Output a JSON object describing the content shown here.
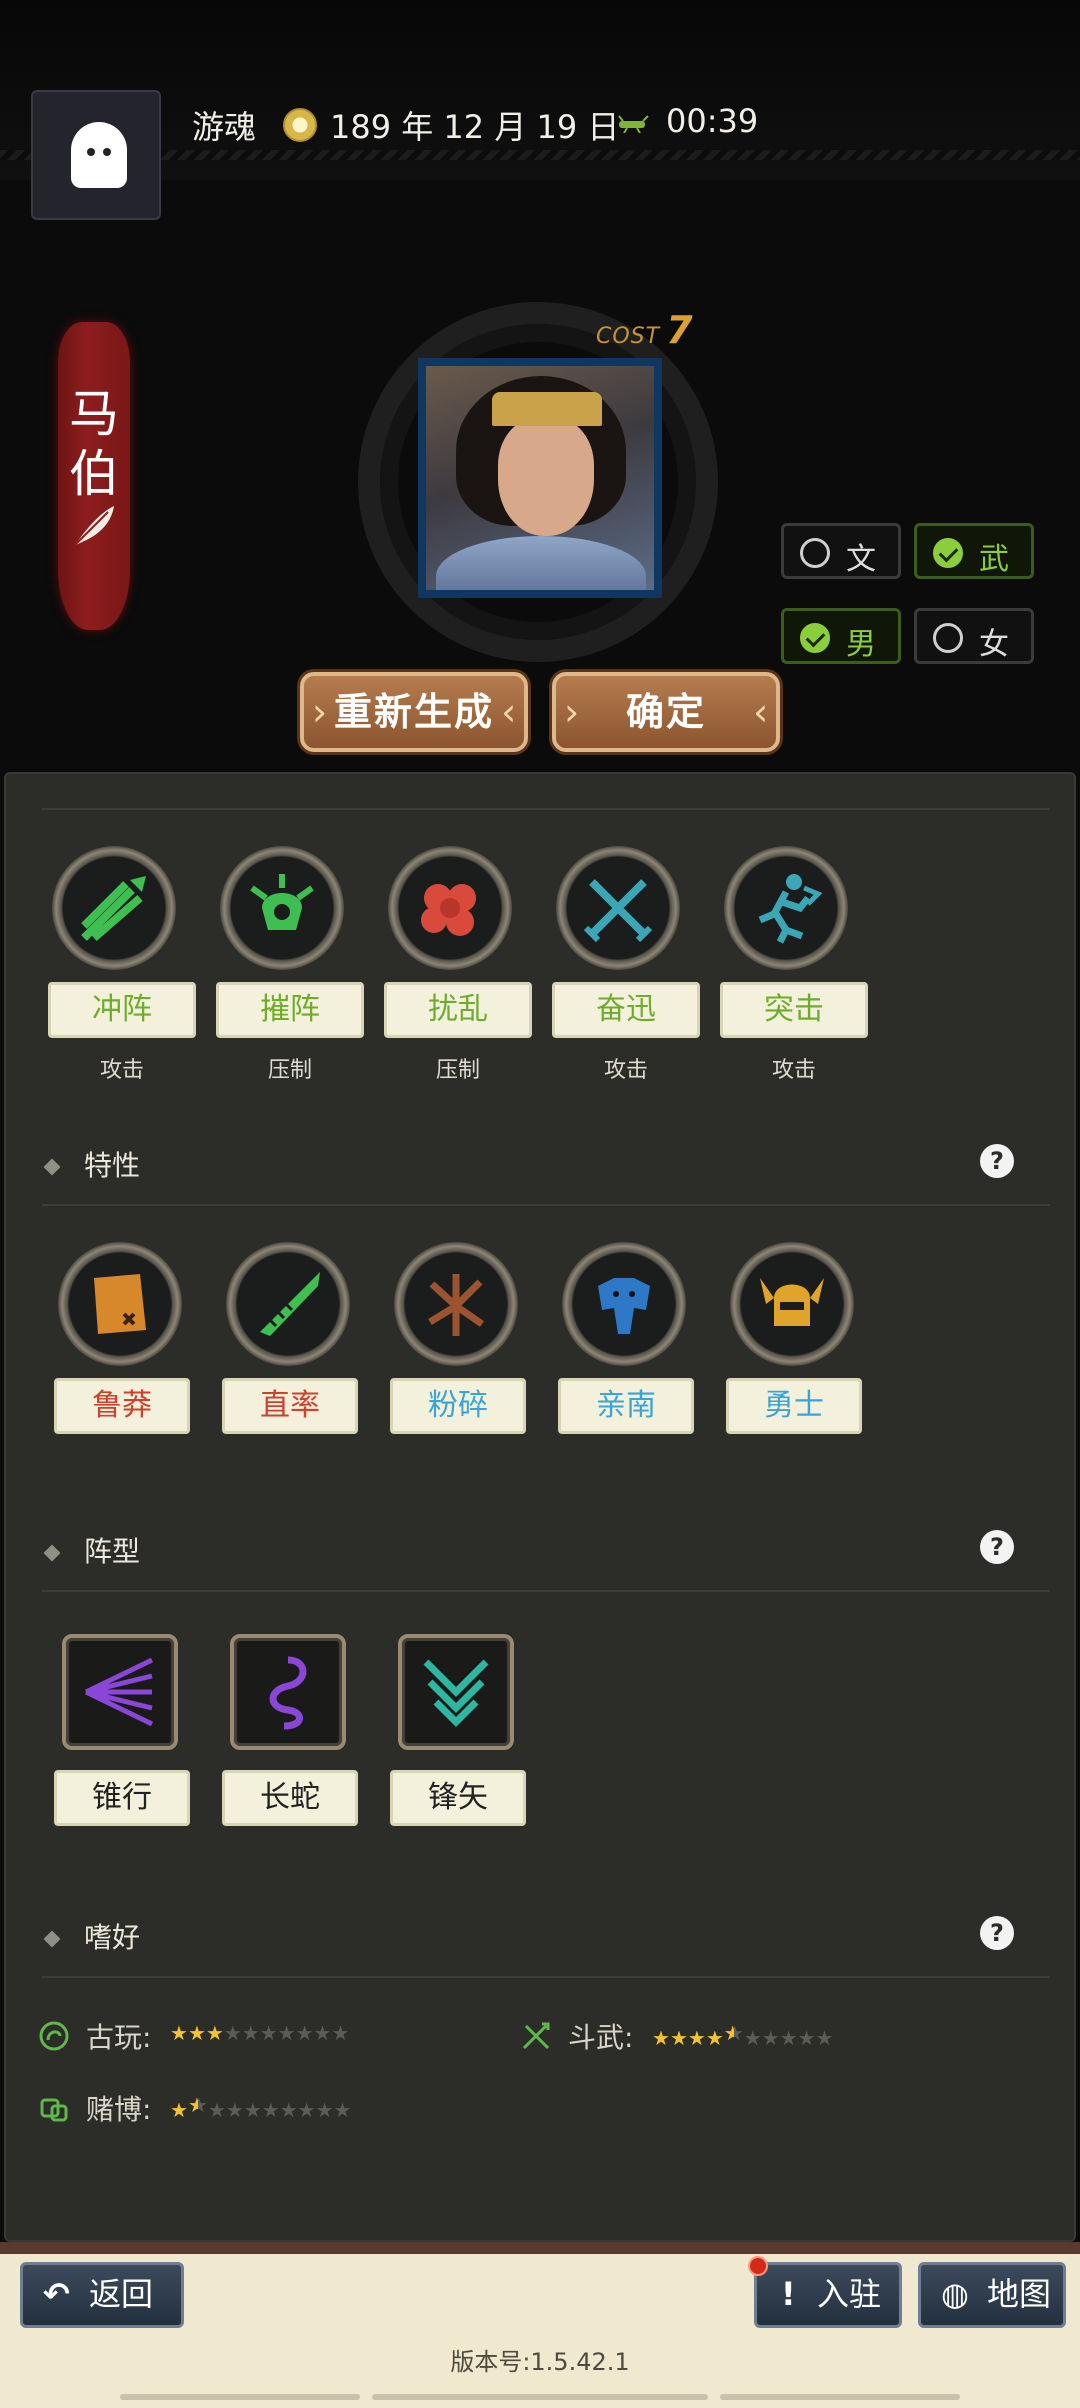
{
  "header": {
    "player_name": "游魂",
    "date": "189 年 12 月 19 日",
    "time": "00:39",
    "coin_icon": "era-coin-icon",
    "clock_icon": "bug-icon"
  },
  "character": {
    "name_chars": [
      "马",
      "伯"
    ],
    "cost_label": "COST",
    "cost_value": "7",
    "toggles": [
      {
        "label": "文",
        "checked": false
      },
      {
        "label": "武",
        "checked": true
      },
      {
        "label": "男",
        "checked": true
      },
      {
        "label": "女",
        "checked": false
      }
    ],
    "regenerate_label": "重新生成",
    "confirm_label": "确定"
  },
  "skills": [
    {
      "label": "冲阵",
      "type": "攻击",
      "icon": "charge-arrows-icon"
    },
    {
      "label": "摧阵",
      "type": "压制",
      "icon": "crush-icon"
    },
    {
      "label": "扰乱",
      "type": "压制",
      "icon": "chaos-cloud-icon"
    },
    {
      "label": "奋迅",
      "type": "攻击",
      "icon": "crossed-swords-icon"
    },
    {
      "label": "突击",
      "type": "攻击",
      "icon": "assault-runner-icon"
    }
  ],
  "traits": {
    "title": "特性",
    "items": [
      {
        "label": "鲁莽",
        "color": "#d0402f",
        "icon": "map-scroll-icon"
      },
      {
        "label": "直率",
        "color": "#d0402f",
        "icon": "arrow-blade-icon"
      },
      {
        "label": "粉碎",
        "color": "#3aa4d6",
        "icon": "shatter-icon"
      },
      {
        "label": "亲南",
        "color": "#3aa4d6",
        "icon": "elephant-icon"
      },
      {
        "label": "勇士",
        "color": "#3aa4d6",
        "icon": "horned-helmet-icon"
      }
    ]
  },
  "formations": {
    "title": "阵型",
    "items": [
      {
        "label": "锥行",
        "icon": "cone-formation-icon"
      },
      {
        "label": "长蛇",
        "icon": "snake-formation-icon"
      },
      {
        "label": "锋矢",
        "icon": "arrowhead-formation-icon"
      }
    ]
  },
  "hobbies": {
    "title": "嗜好",
    "items": [
      {
        "label": "古玩:",
        "stars": 3,
        "max": 10,
        "icon": "antique-icon"
      },
      {
        "label": "斗武:",
        "stars": 4.5,
        "max": 10,
        "icon": "duel-icon"
      },
      {
        "label": "赌博:",
        "stars": 1.5,
        "max": 10,
        "icon": "dice-icon"
      }
    ]
  },
  "bottom": {
    "back_label": "返回",
    "settle_label": "入驻",
    "map_label": "地图",
    "version": "版本号:1.5.42.1"
  }
}
